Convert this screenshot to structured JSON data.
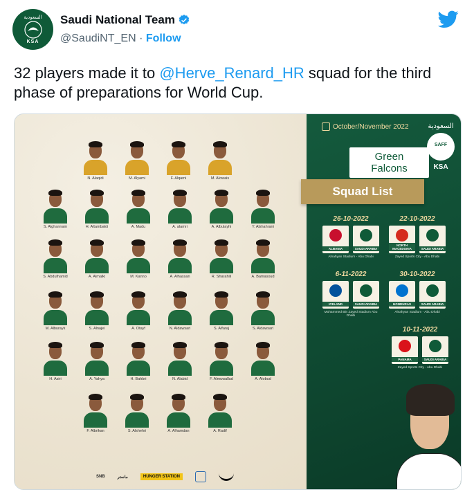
{
  "account": {
    "display_name": "Saudi National Team",
    "handle": "@SaudiNT_EN",
    "separator": "·",
    "follow_label": "Follow",
    "avatar_text": "KSA",
    "avatar_arabic": "السعودية"
  },
  "tweet": {
    "text_before": "32 players made it to ",
    "mention": "@Herve_Renard_HR",
    "text_after": "  squad for the third phase of preparations for World Cup."
  },
  "graphic": {
    "date_range": "October/November 2022",
    "team_name_line1": "Green",
    "team_name_line2": "Falcons",
    "title": "Squad List",
    "logo_arabic": "السعودية",
    "logo_text": "SAFF",
    "logo_ksa": "KSA",
    "players": [
      "N. Alaqidi",
      "M. Alyami",
      "F. Alqarni",
      "M. Alowais",
      "S. Alghannam",
      "H. Altambakti",
      "A. Madu",
      "A. alamri",
      "A. Albulayhi",
      "Y. Alshahrani",
      "S. Abdulhamid",
      "A. Almalki",
      "M. Kanno",
      "A. Alhassan",
      "R. Sharahili",
      "A. Bamasoud",
      "M. Alburayk",
      "S. Alnajei",
      "A. Otayf",
      "N. Aldawsari",
      "S. Alfaraj",
      "S. Aldawsari",
      "H. Asiri",
      "A. Yahya",
      "H. Bahbri",
      "N. Alabid",
      "F. Almuwallad",
      "A. Alobud",
      "F. Albrikan",
      "S. Alshehri",
      "A. Alhamdan",
      "A. Radif"
    ],
    "matches": [
      {
        "date": "26-10-2022",
        "home": "ALBANIA",
        "away": "SAUDI ARABIA",
        "venue": "Alnahyan Stadium - Abu Dhabi"
      },
      {
        "date": "22-10-2022",
        "home": "NORTH MACEDONIA",
        "away": "SAUDI ARABIA",
        "venue": "Zayed Sports City - Abu Dhabi"
      },
      {
        "date": "6-11-2022",
        "home": "ICELAND",
        "away": "SAUDI ARABIA",
        "venue": "Mohammed Bin Zayed Stadium Abu Dhabi"
      },
      {
        "date": "30-10-2022",
        "home": "HONDURAS",
        "away": "SAUDI ARABIA",
        "venue": "Alnahyan Stadium - Abu Dhabi"
      },
      {
        "date": "10-11-2022",
        "home": "PANAMA",
        "away": "SAUDI ARABIA",
        "venue": "Zayed Sports City - Abu Dhabi"
      }
    ],
    "sponsors": [
      "SNB",
      "ماستر",
      "HUNGER STATION",
      "",
      ""
    ]
  },
  "colors": {
    "accent": "#1d9bf0",
    "team_green": "#0f5a38",
    "gold": "#b89a5b"
  }
}
